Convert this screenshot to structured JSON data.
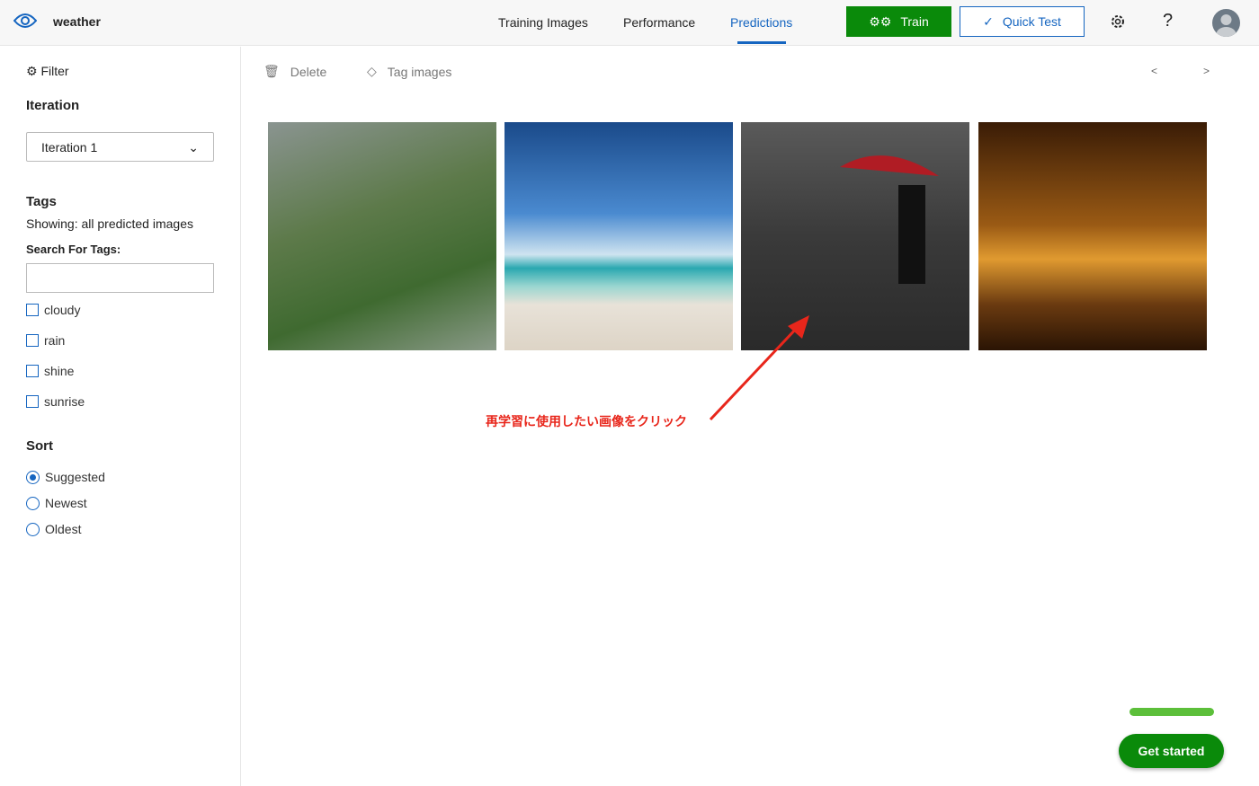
{
  "header": {
    "app_name": "weather",
    "tabs": [
      {
        "label": "Training Images"
      },
      {
        "label": "Performance"
      },
      {
        "label": "Predictions"
      }
    ],
    "train_label": "Train",
    "quick_test_label": "Quick Test",
    "help": "?"
  },
  "sidebar": {
    "filter": "Filter",
    "iteration_heading": "Iteration",
    "iteration_value": "Iteration 1",
    "tags_heading": "Tags",
    "showing": "Showing: all predicted images",
    "search_label": "Search For Tags:",
    "search_value": "",
    "tags": [
      {
        "label": "cloudy",
        "checked": false
      },
      {
        "label": "rain",
        "checked": false
      },
      {
        "label": "shine",
        "checked": false
      },
      {
        "label": "sunrise",
        "checked": false
      }
    ],
    "sort_heading": "Sort",
    "sort": [
      {
        "label": "Suggested",
        "selected": true
      },
      {
        "label": "Newest",
        "selected": false
      },
      {
        "label": "Oldest",
        "selected": false
      }
    ]
  },
  "toolbar": {
    "delete": "Delete",
    "tag_images": "Tag images",
    "prev": "<",
    "next": ">"
  },
  "images": [
    {
      "subject": "rain on trees"
    },
    {
      "subject": "sunny beach"
    },
    {
      "subject": "person with umbrella in rain"
    },
    {
      "subject": "sunset with palm trees"
    }
  ],
  "annotation": "再学習に使用したい画像をクリック",
  "get_started": "Get started",
  "colors": {
    "accent": "#1565c0",
    "green": "#0a8a0a",
    "annotation": "#e8261b"
  }
}
